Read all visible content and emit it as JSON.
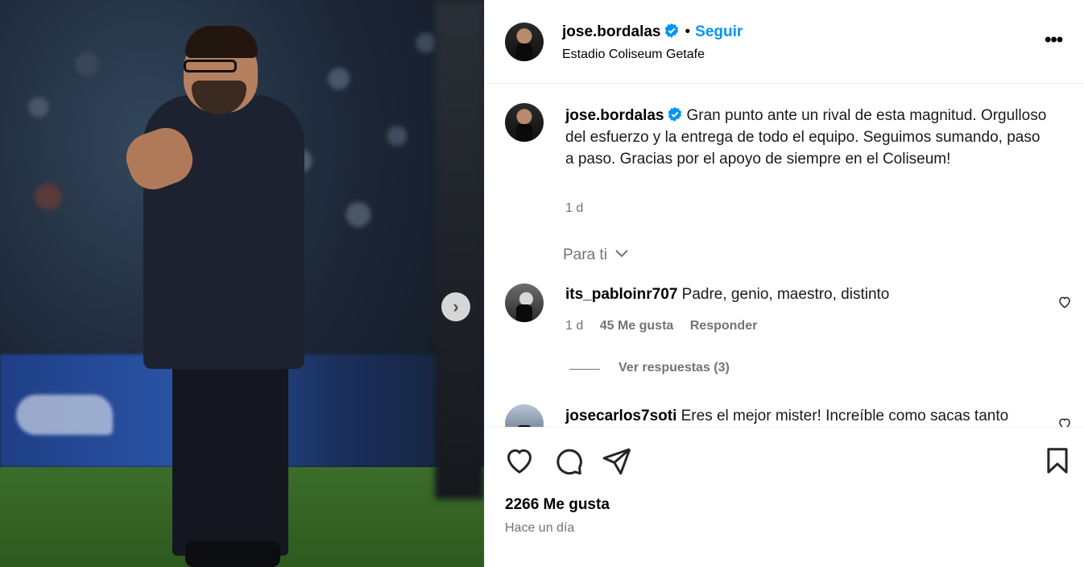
{
  "post": {
    "author": "jose.bordalas",
    "location": "Estadio Coliseum Getafe",
    "follow_label": "Seguir",
    "bullet": "•",
    "more_label": "•••",
    "next_label": "›"
  },
  "caption": {
    "username": "jose.bordalas",
    "text": "Gran punto ante un rival de esta magnitud. Orgulloso del esfuerzo y la entrega de todo el equipo. Seguimos sumando, paso a paso. Gracias por el apoyo de siempre en el Coliseum!",
    "time": "1 d"
  },
  "sort_label": "Para ti",
  "comments": [
    {
      "username": "its_pabloinr707",
      "text": "Padre, genio, maestro, distinto",
      "time": "1 d",
      "likes": "45 Me gusta",
      "reply_label": "Responder",
      "view_replies": "Ver respuestas (3)"
    },
    {
      "username": "josecarlos7soti",
      "text": "Eres el mejor mister! Increíble como sacas tanto"
    }
  ],
  "footer": {
    "likes": "2266 Me gusta",
    "posted": "Hace un día"
  },
  "colors": {
    "accent": "#0095f6",
    "secondary_text": "#737373",
    "divider": "#efefef"
  },
  "icons": [
    "verified-badge-icon",
    "more-options-icon",
    "chevron-right-icon",
    "chevron-down-icon",
    "heart-icon",
    "comment-icon",
    "share-icon",
    "bookmark-icon"
  ]
}
